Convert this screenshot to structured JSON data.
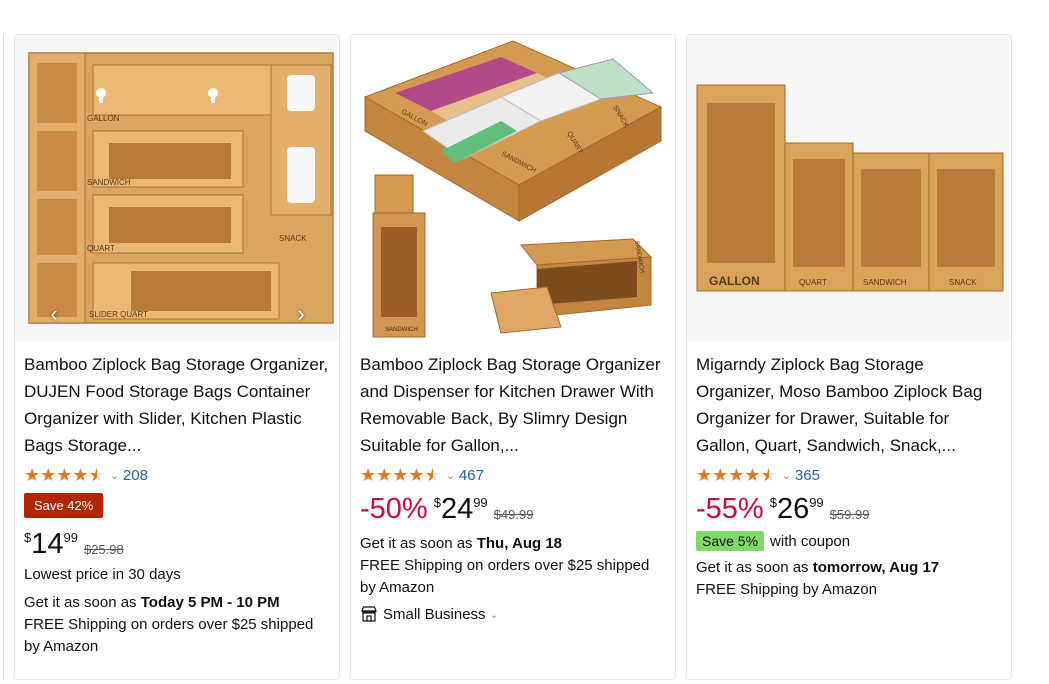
{
  "products": [
    {
      "title": "Bamboo Ziplock Bag Storage Organizer, DUJEN Food Storage Bags Container Organizer with Slider, Kitchen Plastic Bags Storage...",
      "rating": 4.5,
      "review_count": "208",
      "save_badge": "Save 42%",
      "price": {
        "currency": "$",
        "whole": "14",
        "fraction": "99"
      },
      "list_price": "$25.98",
      "lowest_price_note": "Lowest price in 30 days",
      "delivery_prefix": "Get it as soon as ",
      "delivery_date": "Today 5 PM - 10 PM",
      "shipping": "FREE Shipping on orders over $25 shipped by Amazon",
      "image_labels": [
        "GALLON",
        "SANDWICH",
        "QUART",
        "SNACK",
        "SLIDER QUART"
      ],
      "carousel": {
        "prev_icon": "chevron-left-icon",
        "next_icon": "chevron-right-icon"
      }
    },
    {
      "title": "Bamboo Ziplock Bag Storage Organizer and Dispenser for Kitchen Drawer With Removable Back, By Slimry Design Suitable for Gallon,...",
      "rating": 4.5,
      "review_count": "467",
      "discount": "-50%",
      "price": {
        "currency": "$",
        "whole": "24",
        "fraction": "99"
      },
      "list_price": "$49.99",
      "delivery_prefix": "Get it as soon as ",
      "delivery_date": "Thu, Aug 18",
      "shipping": "FREE Shipping on orders over $25 shipped by Amazon",
      "badge_label": "Small Business",
      "image_labels": [
        "GALLON",
        "SANDWICH",
        "QUART",
        "SNACK",
        "SANDWICH",
        "SANDWICH"
      ]
    },
    {
      "title": "Migarndy Ziplock Bag Storage Organizer, Moso Bamboo Ziplock Bag Organizer for Drawer, Suitable for Gallon, Quart, Sandwich, Snack,...",
      "rating": 4.5,
      "review_count": "365",
      "discount": "-55%",
      "price": {
        "currency": "$",
        "whole": "26",
        "fraction": "99"
      },
      "list_price": "$59.99",
      "coupon_badge": "Save 5%",
      "coupon_text": "with coupon",
      "delivery_prefix": "Get it as soon as ",
      "delivery_date": "tomorrow, Aug 17",
      "shipping": "FREE Shipping by Amazon",
      "image_labels": [
        "GALLON",
        "QUART",
        "SANDWICH",
        "SNACK"
      ]
    }
  ],
  "colors": {
    "price_discount": "#cc0c39",
    "save_badge_bg": "#b12704",
    "coupon_bg": "#7fda69",
    "star": "#de7921",
    "link": "#2162a1",
    "bamboo": "#d8a35b"
  }
}
